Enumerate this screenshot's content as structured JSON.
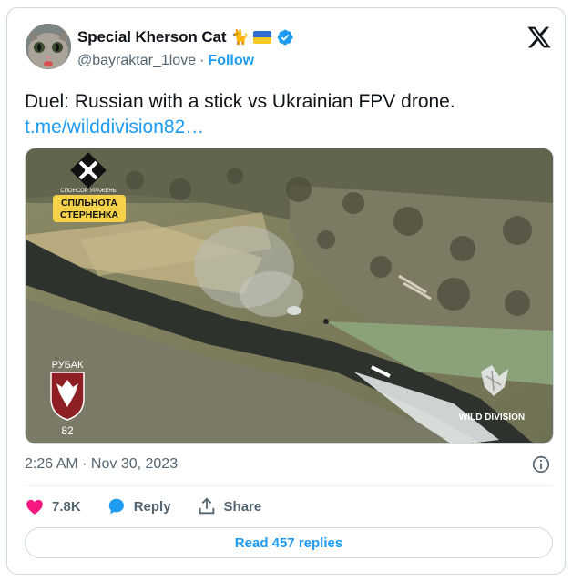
{
  "author": {
    "display_name": "Special Kherson Cat",
    "handle": "@bayraktar_1love",
    "separator": "·",
    "follow_label": "Follow",
    "emoji": "🐈",
    "flag_colors": [
      "#2f6fd1",
      "#f6c924"
    ],
    "verified_color": "#1d9bf0"
  },
  "tweet": {
    "text": "Duel: Russian with a stick vs Ukrainian FPV drone.",
    "link": "t.me/wilddivision82…"
  },
  "media": {
    "sponsor_small": "СПОНСОР УРАЖЕНЬ",
    "sponsor_line1": "СПІЛЬНОТА",
    "sponsor_line2": "СТЕРНЕНКА",
    "unit_name": "РУБАК",
    "unit_number": "82",
    "watermark": "WILD DIVISION"
  },
  "meta": {
    "timestamp": "2:26 AM · Nov 30, 2023"
  },
  "actions": {
    "likes": "7.8K",
    "reply_label": "Reply",
    "share_label": "Share",
    "like_color": "#f91880"
  },
  "read_replies_label": "Read 457 replies",
  "accent_color": "#1d9bf0"
}
